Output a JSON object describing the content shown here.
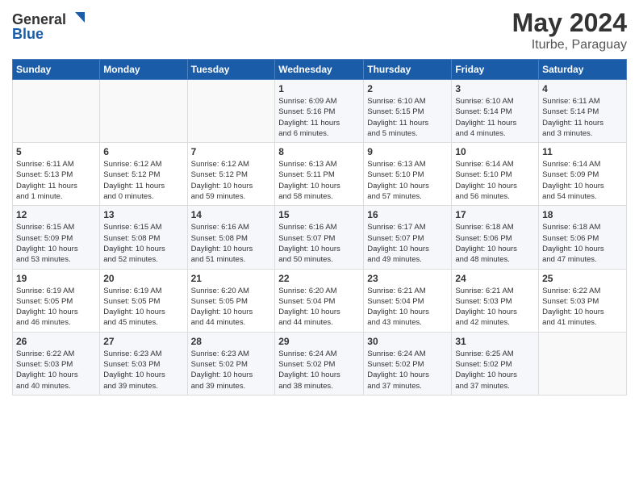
{
  "header": {
    "logo_general": "General",
    "logo_blue": "Blue",
    "title": "May 2024",
    "subtitle": "Iturbe, Paraguay"
  },
  "calendar": {
    "days_of_week": [
      "Sunday",
      "Monday",
      "Tuesday",
      "Wednesday",
      "Thursday",
      "Friday",
      "Saturday"
    ],
    "weeks": [
      [
        {
          "day": "",
          "info": ""
        },
        {
          "day": "",
          "info": ""
        },
        {
          "day": "",
          "info": ""
        },
        {
          "day": "1",
          "info": "Sunrise: 6:09 AM\nSunset: 5:16 PM\nDaylight: 11 hours\nand 6 minutes."
        },
        {
          "day": "2",
          "info": "Sunrise: 6:10 AM\nSunset: 5:15 PM\nDaylight: 11 hours\nand 5 minutes."
        },
        {
          "day": "3",
          "info": "Sunrise: 6:10 AM\nSunset: 5:14 PM\nDaylight: 11 hours\nand 4 minutes."
        },
        {
          "day": "4",
          "info": "Sunrise: 6:11 AM\nSunset: 5:14 PM\nDaylight: 11 hours\nand 3 minutes."
        }
      ],
      [
        {
          "day": "5",
          "info": "Sunrise: 6:11 AM\nSunset: 5:13 PM\nDaylight: 11 hours\nand 1 minute."
        },
        {
          "day": "6",
          "info": "Sunrise: 6:12 AM\nSunset: 5:12 PM\nDaylight: 11 hours\nand 0 minutes."
        },
        {
          "day": "7",
          "info": "Sunrise: 6:12 AM\nSunset: 5:12 PM\nDaylight: 10 hours\nand 59 minutes."
        },
        {
          "day": "8",
          "info": "Sunrise: 6:13 AM\nSunset: 5:11 PM\nDaylight: 10 hours\nand 58 minutes."
        },
        {
          "day": "9",
          "info": "Sunrise: 6:13 AM\nSunset: 5:10 PM\nDaylight: 10 hours\nand 57 minutes."
        },
        {
          "day": "10",
          "info": "Sunrise: 6:14 AM\nSunset: 5:10 PM\nDaylight: 10 hours\nand 56 minutes."
        },
        {
          "day": "11",
          "info": "Sunrise: 6:14 AM\nSunset: 5:09 PM\nDaylight: 10 hours\nand 54 minutes."
        }
      ],
      [
        {
          "day": "12",
          "info": "Sunrise: 6:15 AM\nSunset: 5:09 PM\nDaylight: 10 hours\nand 53 minutes."
        },
        {
          "day": "13",
          "info": "Sunrise: 6:15 AM\nSunset: 5:08 PM\nDaylight: 10 hours\nand 52 minutes."
        },
        {
          "day": "14",
          "info": "Sunrise: 6:16 AM\nSunset: 5:08 PM\nDaylight: 10 hours\nand 51 minutes."
        },
        {
          "day": "15",
          "info": "Sunrise: 6:16 AM\nSunset: 5:07 PM\nDaylight: 10 hours\nand 50 minutes."
        },
        {
          "day": "16",
          "info": "Sunrise: 6:17 AM\nSunset: 5:07 PM\nDaylight: 10 hours\nand 49 minutes."
        },
        {
          "day": "17",
          "info": "Sunrise: 6:18 AM\nSunset: 5:06 PM\nDaylight: 10 hours\nand 48 minutes."
        },
        {
          "day": "18",
          "info": "Sunrise: 6:18 AM\nSunset: 5:06 PM\nDaylight: 10 hours\nand 47 minutes."
        }
      ],
      [
        {
          "day": "19",
          "info": "Sunrise: 6:19 AM\nSunset: 5:05 PM\nDaylight: 10 hours\nand 46 minutes."
        },
        {
          "day": "20",
          "info": "Sunrise: 6:19 AM\nSunset: 5:05 PM\nDaylight: 10 hours\nand 45 minutes."
        },
        {
          "day": "21",
          "info": "Sunrise: 6:20 AM\nSunset: 5:05 PM\nDaylight: 10 hours\nand 44 minutes."
        },
        {
          "day": "22",
          "info": "Sunrise: 6:20 AM\nSunset: 5:04 PM\nDaylight: 10 hours\nand 44 minutes."
        },
        {
          "day": "23",
          "info": "Sunrise: 6:21 AM\nSunset: 5:04 PM\nDaylight: 10 hours\nand 43 minutes."
        },
        {
          "day": "24",
          "info": "Sunrise: 6:21 AM\nSunset: 5:03 PM\nDaylight: 10 hours\nand 42 minutes."
        },
        {
          "day": "25",
          "info": "Sunrise: 6:22 AM\nSunset: 5:03 PM\nDaylight: 10 hours\nand 41 minutes."
        }
      ],
      [
        {
          "day": "26",
          "info": "Sunrise: 6:22 AM\nSunset: 5:03 PM\nDaylight: 10 hours\nand 40 minutes."
        },
        {
          "day": "27",
          "info": "Sunrise: 6:23 AM\nSunset: 5:03 PM\nDaylight: 10 hours\nand 39 minutes."
        },
        {
          "day": "28",
          "info": "Sunrise: 6:23 AM\nSunset: 5:02 PM\nDaylight: 10 hours\nand 39 minutes."
        },
        {
          "day": "29",
          "info": "Sunrise: 6:24 AM\nSunset: 5:02 PM\nDaylight: 10 hours\nand 38 minutes."
        },
        {
          "day": "30",
          "info": "Sunrise: 6:24 AM\nSunset: 5:02 PM\nDaylight: 10 hours\nand 37 minutes."
        },
        {
          "day": "31",
          "info": "Sunrise: 6:25 AM\nSunset: 5:02 PM\nDaylight: 10 hours\nand 37 minutes."
        },
        {
          "day": "",
          "info": ""
        }
      ]
    ]
  }
}
